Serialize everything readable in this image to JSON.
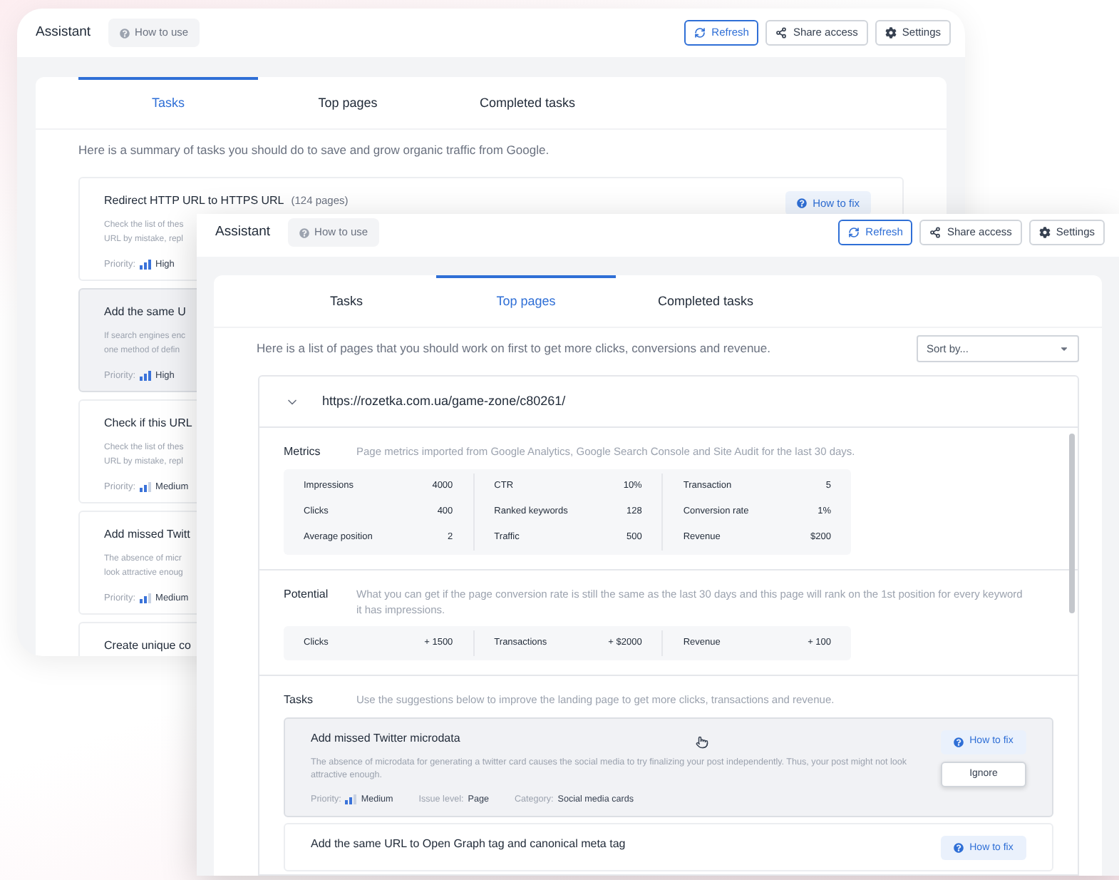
{
  "background_window": {
    "title": "Assistant",
    "help_button": "How to use",
    "actions": [
      {
        "label": "Refresh",
        "kind": "refresh",
        "highlighted": true
      },
      {
        "label": "Share access",
        "kind": "share",
        "highlighted": false
      },
      {
        "label": "Settings",
        "kind": "settings",
        "highlighted": false
      }
    ],
    "tabs": [
      {
        "label": "Tasks",
        "selected": true
      },
      {
        "label": "Top pages",
        "selected": false
      },
      {
        "label": "Completed tasks",
        "selected": false
      }
    ],
    "summary": "Here is a summary of tasks you should do to save and grow organic traffic from Google.",
    "tasks": [
      {
        "title": "Redirect HTTP URL to HTTPS URL",
        "count": "(124 pages)",
        "description": [
          "Check the list of thes",
          "URL by mistake, repl"
        ],
        "priority_label": "Priority:",
        "priority": {
          "label": "High",
          "kind": "high"
        },
        "highlighted": false,
        "fix_button": "How to fix"
      },
      {
        "title": "Add the same U",
        "description": [
          "If search engines enc",
          "one method of defin"
        ],
        "priority_label": "Priority:",
        "priority": {
          "label": "High",
          "kind": "high"
        },
        "highlighted": true
      },
      {
        "title": "Check if this URL",
        "description": [
          "Check the list of thes",
          "URL by mistake, repl"
        ],
        "priority_label": "Priority:",
        "priority": {
          "label": "Medium",
          "kind": "medium"
        },
        "highlighted": false
      },
      {
        "title": "Add missed Twitt",
        "description": [
          "The absence of micr",
          "look attractive enoug"
        ],
        "priority_label": "Priority:",
        "priority": {
          "label": "Medium",
          "kind": "medium"
        },
        "highlighted": false
      },
      {
        "title": "Create unique co",
        "highlighted": false
      }
    ]
  },
  "front_window": {
    "title": "Assistant",
    "help_button": "How to use",
    "actions": [
      {
        "label": "Refresh",
        "kind": "refresh",
        "highlighted": true
      },
      {
        "label": "Share access",
        "kind": "share",
        "highlighted": false
      },
      {
        "label": "Settings",
        "kind": "settings",
        "highlighted": false
      }
    ],
    "tabs": [
      {
        "label": "Tasks",
        "selected": false
      },
      {
        "label": "Top pages",
        "selected": true
      },
      {
        "label": "Completed tasks",
        "selected": false
      }
    ],
    "summary": "Here is a list of pages that you should work on first to get more clicks, conversions and revenue.",
    "sort": {
      "placeholder": "Sort by..."
    },
    "page": {
      "url": "https://rozetka.com.ua/game-zone/c80261/",
      "expanded": true,
      "sections": [
        {
          "kind": "metrics",
          "label": "Metrics",
          "description": "Page metrics imported from Google Analytics, Google Search Console and Site Audit for the last 30 days.",
          "columns": [
            [
              {
                "label": "Impressions",
                "value": "4000"
              },
              {
                "label": "Clicks",
                "value": "400"
              },
              {
                "label": "Average position",
                "value": "2"
              }
            ],
            [
              {
                "label": "CTR",
                "value": "10%"
              },
              {
                "label": "Ranked keywords",
                "value": "128"
              },
              {
                "label": "Traffic",
                "value": "500"
              }
            ],
            [
              {
                "label": "Transaction",
                "value": "5"
              },
              {
                "label": "Conversion rate",
                "value": "1%"
              },
              {
                "label": "Revenue",
                "value": "$200"
              }
            ]
          ]
        },
        {
          "kind": "metrics",
          "label": "Potential",
          "description": "What you can get if the page conversion rate is still the same as the last 30 days and this page will rank on the 1st position for every keyword it has impressions.",
          "columns": [
            [
              {
                "label": "Clicks",
                "value": "+ 1500"
              }
            ],
            [
              {
                "label": "Transactions",
                "value": "+ $2000"
              }
            ],
            [
              {
                "label": "Revenue",
                "value": "+ 100"
              }
            ]
          ]
        },
        {
          "kind": "tasks",
          "label": "Tasks",
          "description": "Use the suggestions below to improve the landing page to get more clicks, transactions and revenue.",
          "items": [
            {
              "title": "Add missed Twitter microdata",
              "description": "The absence of microdata for generating a twitter card causes the social media to try finalizing your post independently. Thus, your post might not look attractive enough.",
              "highlighted": true,
              "meta": [
                {
                  "label": "Priority:",
                  "value": "Medium",
                  "kind": "medium"
                },
                {
                  "label": "Issue level:",
                  "value": "Page"
                },
                {
                  "label": "Category:",
                  "value": "Social media cards"
                }
              ],
              "buttons": [
                {
                  "label": "How to fix",
                  "kind": "help"
                },
                {
                  "label": "Ignore",
                  "kind": "plain"
                }
              ]
            },
            {
              "title": "Add the same URL to Open Graph tag and canonical meta tag",
              "highlighted": false,
              "buttons": [
                {
                  "label": "How to fix",
                  "kind": "help"
                }
              ]
            }
          ]
        }
      ]
    }
  }
}
